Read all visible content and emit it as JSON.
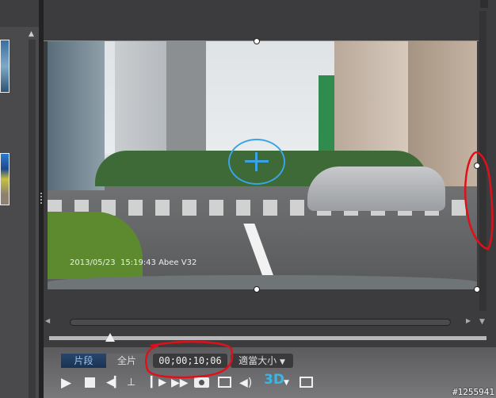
{
  "video": {
    "overlay_text": "2013/05/23  15:19:43 Abee V32"
  },
  "view_tabs": [
    {
      "label": "片段",
      "active": true
    },
    {
      "label": "全片",
      "active": false
    }
  ],
  "timecode": "00;00;10;06",
  "zoom_select": {
    "value": "適當大小"
  },
  "playback": {
    "position_fraction": 0.14
  },
  "buttons": {
    "three_d": "3D"
  },
  "watermark": "#1255941",
  "colors": {
    "annotation": "#e0101a",
    "active_tab": "#1f3b5e",
    "three_d": "#35b8e8"
  }
}
